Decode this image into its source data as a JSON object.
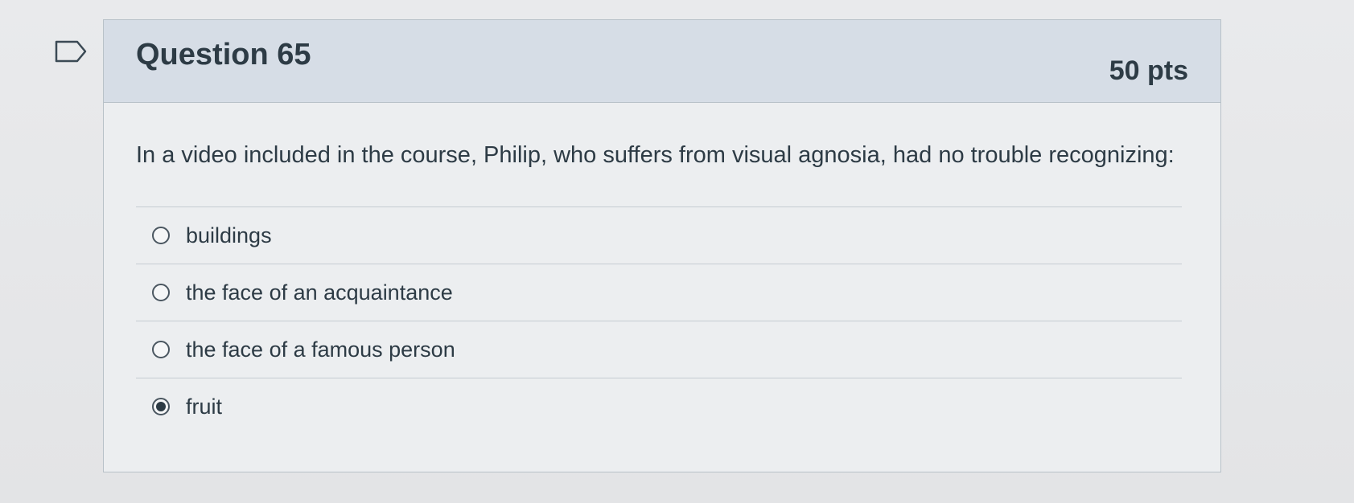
{
  "question": {
    "title": "Question 65",
    "points": "50 pts",
    "text": "In a video included in the course, Philip, who suffers from visual agnosia, had no trouble recognizing:",
    "flag_icon": "flag-outline-icon"
  },
  "answers": [
    {
      "label": "buildings",
      "selected": false
    },
    {
      "label": "the face of an acquaintance",
      "selected": false
    },
    {
      "label": "the face of a famous person",
      "selected": false
    },
    {
      "label": "fruit",
      "selected": true
    }
  ]
}
